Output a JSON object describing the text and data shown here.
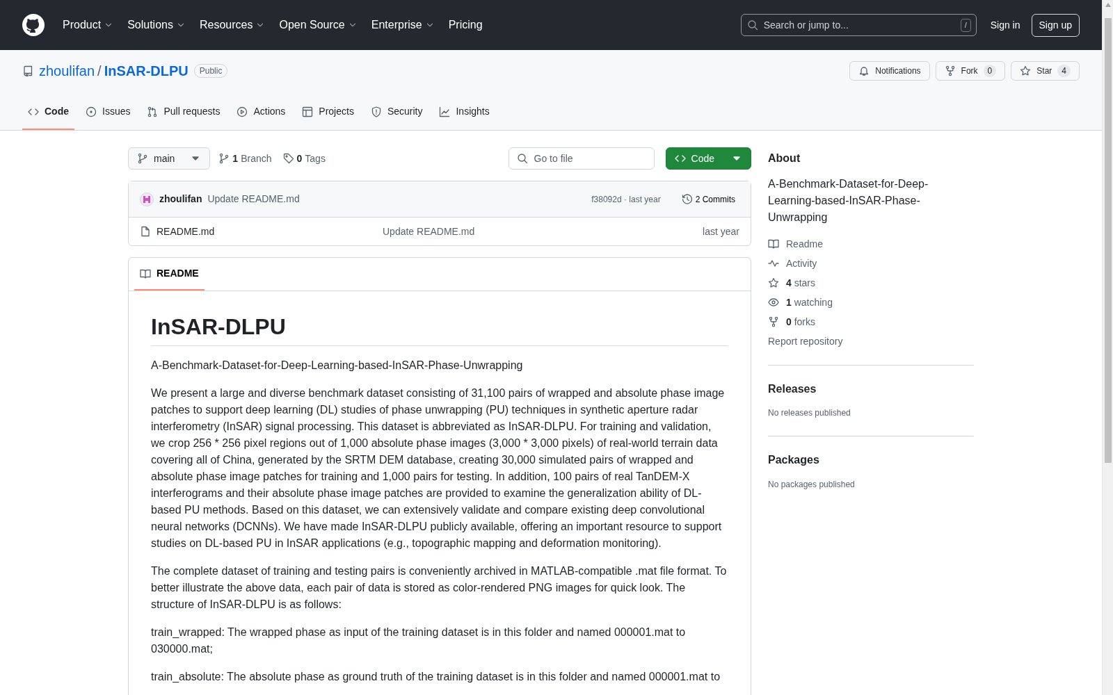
{
  "header": {
    "nav": [
      {
        "label": "Product",
        "dropdown": true
      },
      {
        "label": "Solutions",
        "dropdown": true
      },
      {
        "label": "Resources",
        "dropdown": true
      },
      {
        "label": "Open Source",
        "dropdown": true
      },
      {
        "label": "Enterprise",
        "dropdown": true
      },
      {
        "label": "Pricing",
        "dropdown": false
      }
    ],
    "search": {
      "placeholder": "Search or jump to...",
      "shortcut": "/"
    },
    "sign_in": "Sign in",
    "sign_up": "Sign up"
  },
  "repo": {
    "owner": "zhoulifan",
    "separator": "/",
    "name": "InSAR-DLPU",
    "visibility": "Public",
    "actions": [
      {
        "kind": "bell",
        "label": "Notifications"
      },
      {
        "kind": "fork",
        "label": "Fork",
        "count": "0"
      },
      {
        "kind": "star",
        "label": "Star",
        "count": "4"
      }
    ],
    "tabs": [
      {
        "label": "Code",
        "selected": true
      },
      {
        "label": "Issues",
        "selected": false
      },
      {
        "label": "Pull requests",
        "selected": false
      },
      {
        "label": "Actions",
        "selected": false
      },
      {
        "label": "Projects",
        "selected": false
      },
      {
        "label": "Security",
        "selected": false
      },
      {
        "label": "Insights",
        "selected": false
      }
    ]
  },
  "toolbar": {
    "branch": "main",
    "branches": {
      "count": "1",
      "label": "Branch"
    },
    "tags": {
      "count": "0",
      "label": "Tags"
    },
    "go_to_file": {
      "placeholder": "Go to file"
    },
    "code_button": "Code"
  },
  "commit": {
    "author": "zhoulifan",
    "message": "Update README.md",
    "hash": "f38092d · last year",
    "commits": "2 Commits"
  },
  "files": [
    {
      "name": "README.md",
      "message": "Update README.md",
      "time": "last year"
    }
  ],
  "readme": {
    "tab": "README",
    "title": "InSAR-DLPU",
    "paragraphs": [
      "A-Benchmark-Dataset-for-Deep-Learning-based-InSAR-Phase-Unwrapping",
      "We present a large and diverse benchmark dataset consisting of 31,100 pairs of wrapped and absolute phase image patches to support deep learning (DL) studies of phase unwrapping (PU) techniques in synthetic aperture radar interferometry (InSAR) signal processing. This dataset is abbreviated as InSAR-DLPU. For training and validation, we crop 256 * 256 pixel regions out of 1,000 absolute phase images (3,000 * 3,000 pixels) of real-world terrain data covering all of China, generated by the SRTM DEM database, creating 30,000 simulated pairs of wrapped and absolute phase image patches for training and 1,000 pairs for testing. In addition, 100 pairs of real TanDEM-X interferograms and their absolute phase image patches are provided to examine the generalization ability of DL-based PU methods. Based on this dataset, we can extensively validate and compare existing deep convolutional neural networks (DCNNs). We have made InSAR-DLPU publicly available, offering an important resource to support studies on DL-based PU in InSAR applications (e.g., topographic mapping and deformation monitoring).",
      "The complete dataset of training and testing pairs is conveniently archived in MATLAB-compatible .mat file format. To better illustrate the above data, each pair of data is stored as color-rendered PNG images for quick look. The structure of InSAR-DLPU is as follows:",
      "train_wrapped: The wrapped phase as input of the training dataset is in this folder and named 000001.mat to 030000.mat;",
      "train_absolute: The absolute phase as ground truth of the training dataset is in this folder and named 000001.mat to"
    ]
  },
  "about": {
    "heading": "About",
    "description": "A-Benchmark-Dataset-for-Deep-Learning-based-InSAR-Phase-Unwrapping",
    "links": [
      {
        "label": "Readme"
      },
      {
        "label": "Activity"
      },
      {
        "count": "4",
        "label": "stars"
      },
      {
        "count": "1",
        "label": "watching"
      },
      {
        "count": "0",
        "label": "forks"
      }
    ],
    "report": "Report repository"
  },
  "sections": [
    {
      "heading": "Releases",
      "note": "No releases published"
    },
    {
      "heading": "Packages",
      "note": "No packages published"
    }
  ]
}
